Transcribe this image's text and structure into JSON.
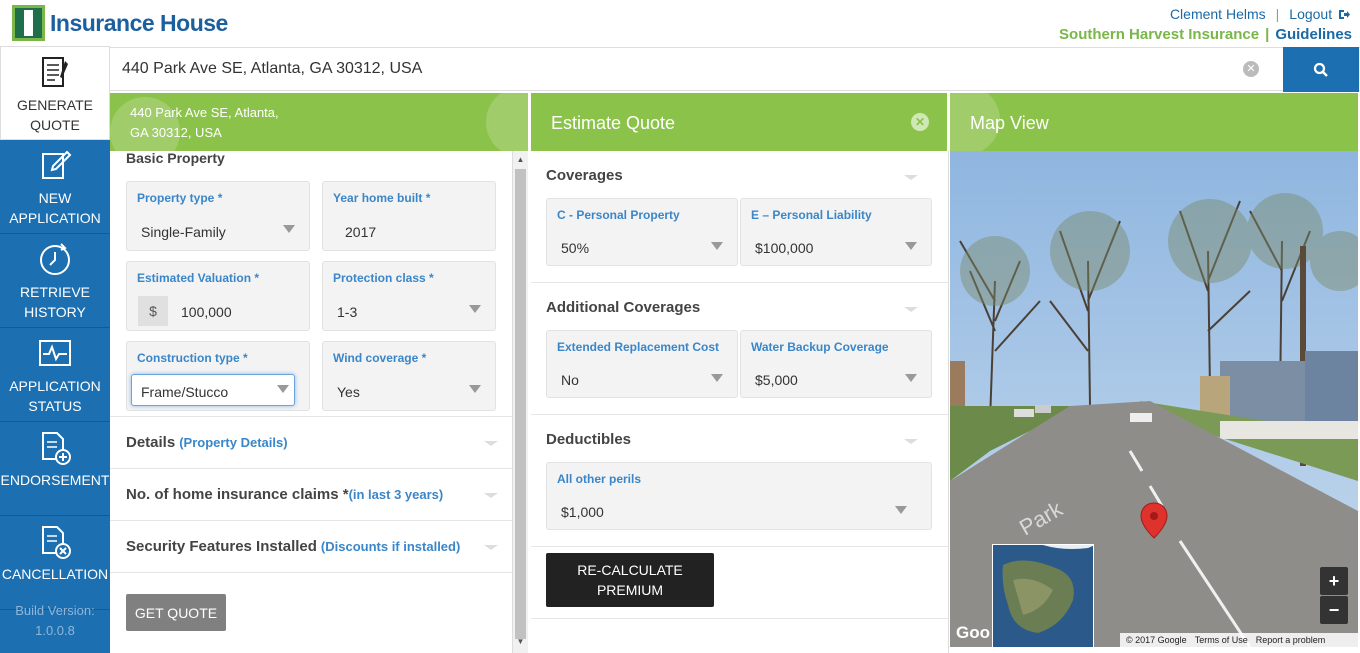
{
  "header": {
    "logo_text": "Insurance House",
    "user_name": "Clement Helms",
    "logout_label": "Logout",
    "company_name": "Southern Harvest Insurance",
    "guidelines_label": "Guidelines"
  },
  "sidebar": {
    "items": [
      {
        "label_line1": "GENERATE",
        "label_line2": "QUOTE"
      },
      {
        "label_line1": "NEW",
        "label_line2": "APPLICATION"
      },
      {
        "label_line1": "RETRIEVE",
        "label_line2": "HISTORY"
      },
      {
        "label_line1": "APPLICATION",
        "label_line2": "STATUS"
      },
      {
        "label_line1": "",
        "label_line2": "ENDORSEMENT"
      },
      {
        "label_line1": "",
        "label_line2": "CANCELLATION"
      }
    ],
    "build_label": "Build Version:",
    "build_version": "1.0.0.8"
  },
  "search": {
    "value": "440 Park Ave SE, Atlanta, GA 30312, USA"
  },
  "panels": {
    "address_line1": "440 Park Ave SE, Atlanta,",
    "address_line2": "GA 30312, USA",
    "estimate_title": "Estimate Quote",
    "map_title": "Map View"
  },
  "basic_property": {
    "title": "Basic Property",
    "fields": [
      {
        "label": "Property type *",
        "value": "Single-Family"
      },
      {
        "label": "Year home built *",
        "value": "2017"
      },
      {
        "label": "Estimated Valuation *",
        "prefix": "$",
        "value": "100,000"
      },
      {
        "label": "Protection class *",
        "value": "1-3"
      },
      {
        "label": "Construction type *",
        "value": "Frame/Stucco"
      },
      {
        "label": "Wind coverage *",
        "value": "Yes"
      }
    ]
  },
  "accordions": [
    {
      "title": "Details",
      "sub": "(Property Details)"
    },
    {
      "title": "No. of home insurance claims *",
      "sub": "(in last 3 years)"
    },
    {
      "title": "Security Features Installed",
      "sub": "(Discounts if installed)"
    }
  ],
  "get_quote_label": "GET QUOTE",
  "coverages": {
    "title": "Coverages",
    "fields": [
      {
        "label": "C - Personal Property",
        "value": "50%"
      },
      {
        "label": "E – Personal Liability",
        "value": "$100,000"
      }
    ]
  },
  "additional_coverages": {
    "title": "Additional Coverages",
    "fields": [
      {
        "label": "Extended Replacement Cost",
        "value": "No"
      },
      {
        "label": "Water Backup Coverage",
        "value": "$5,000"
      }
    ]
  },
  "deductibles": {
    "title": "Deductibles",
    "fields": [
      {
        "label": "All other perils",
        "value": "$1,000"
      }
    ]
  },
  "recalc": {
    "line1": "RE-CALCULATE",
    "line2": "PREMIUM"
  },
  "map": {
    "google_label": "Goo",
    "copyright": "© 2017 Google",
    "terms": "Terms of Use",
    "report": "Report a problem",
    "zoom_in": "+",
    "zoom_out": "−"
  }
}
